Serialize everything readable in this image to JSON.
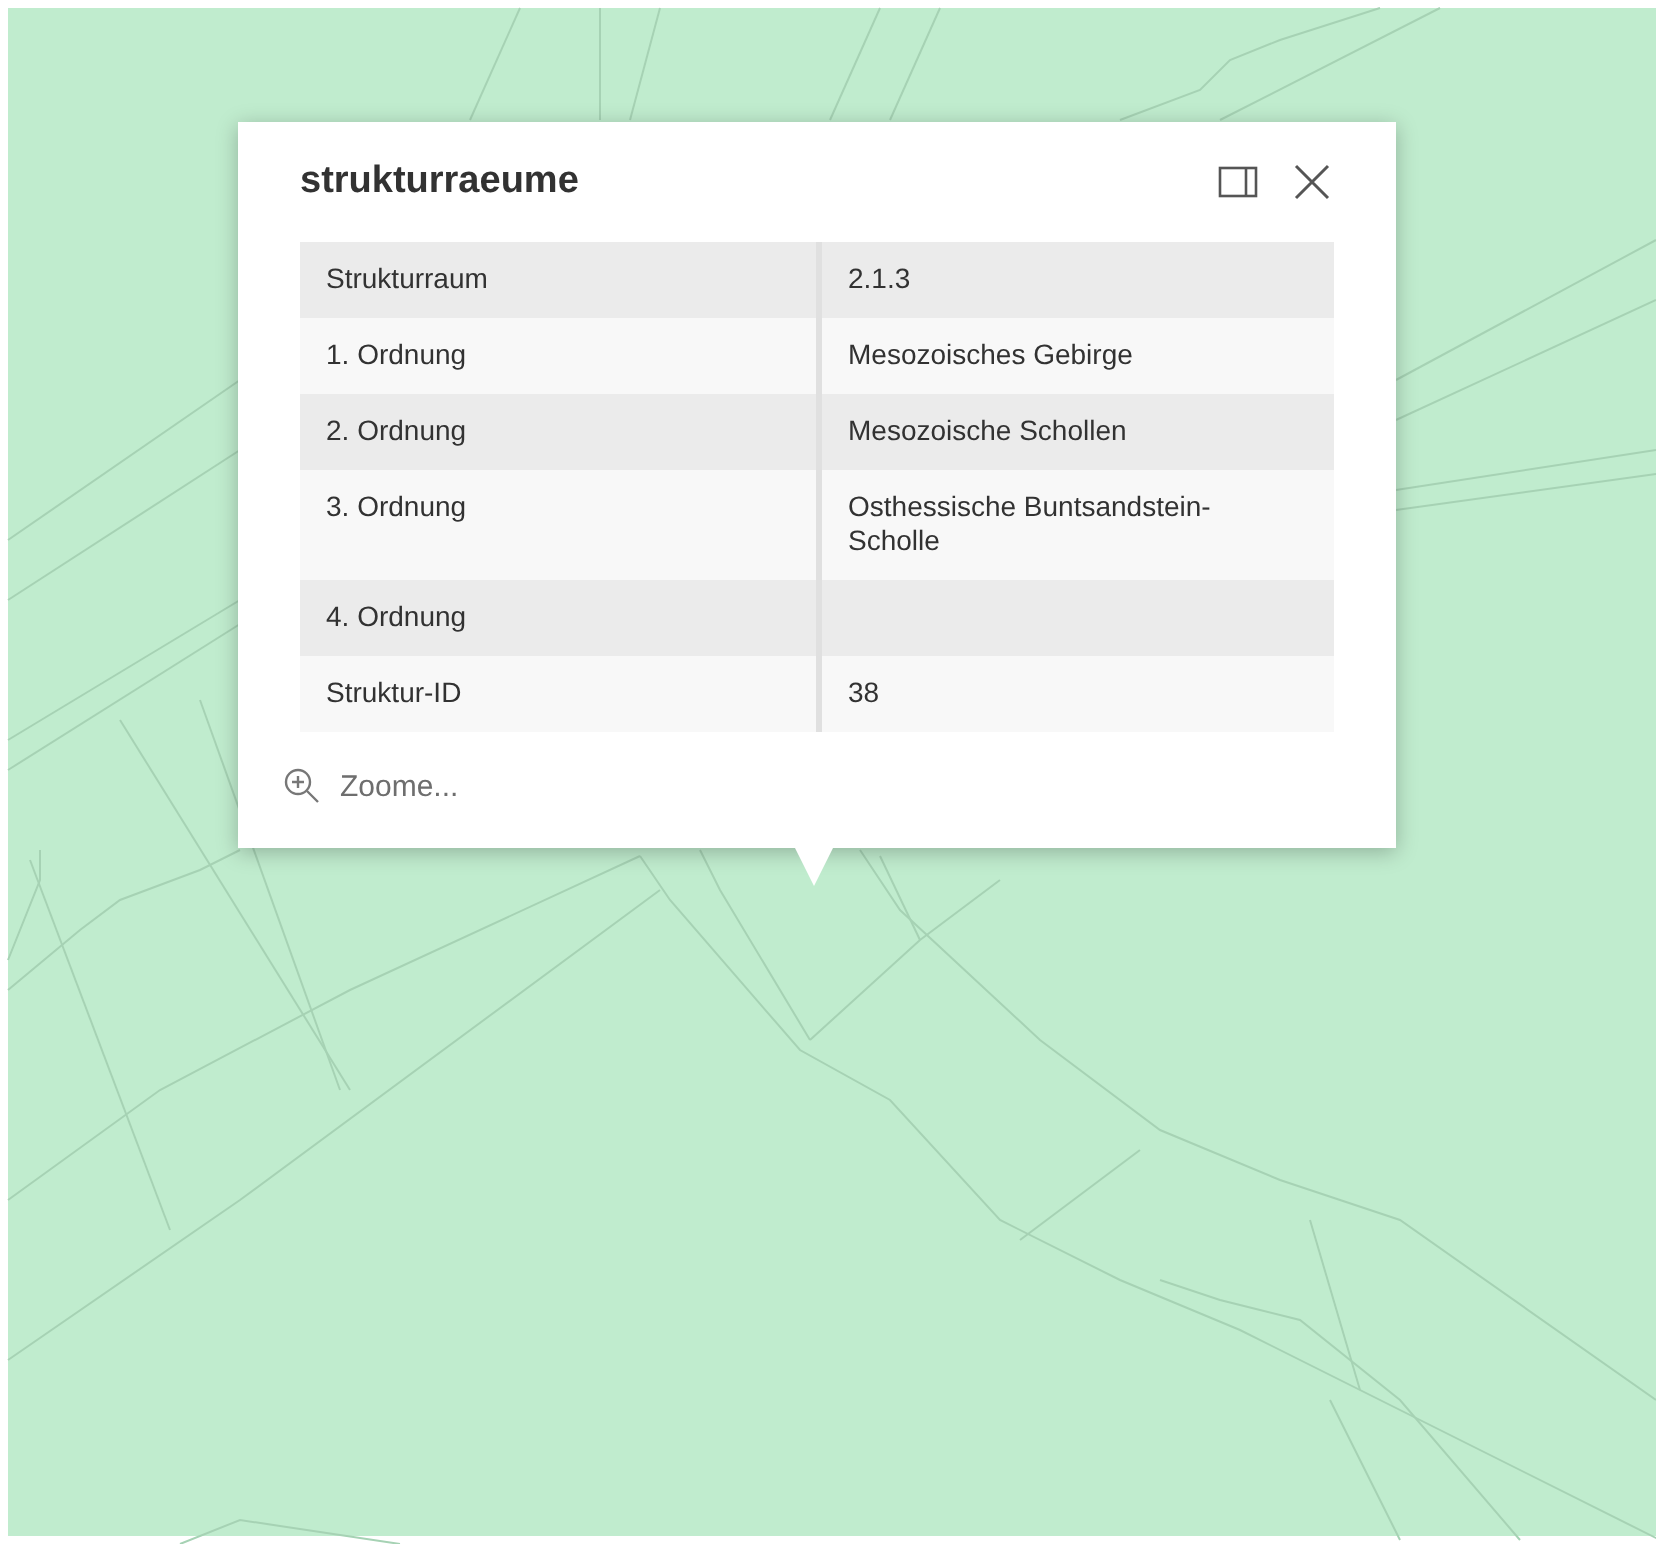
{
  "popup": {
    "title": "strukturraeume",
    "rows": [
      {
        "label": "Strukturraum",
        "value": "2.1.3"
      },
      {
        "label": "1. Ordnung",
        "value": "Mesozoisches Gebirge"
      },
      {
        "label": "2. Ordnung",
        "value": "Mesozoische Schollen"
      },
      {
        "label": "3. Ordnung",
        "value": "Osthessische Buntsandstein-Scholle"
      },
      {
        "label": "4. Ordnung",
        "value": ""
      },
      {
        "label": "Struktur-ID",
        "value": "38"
      }
    ],
    "zoom_action": "Zoome..."
  }
}
